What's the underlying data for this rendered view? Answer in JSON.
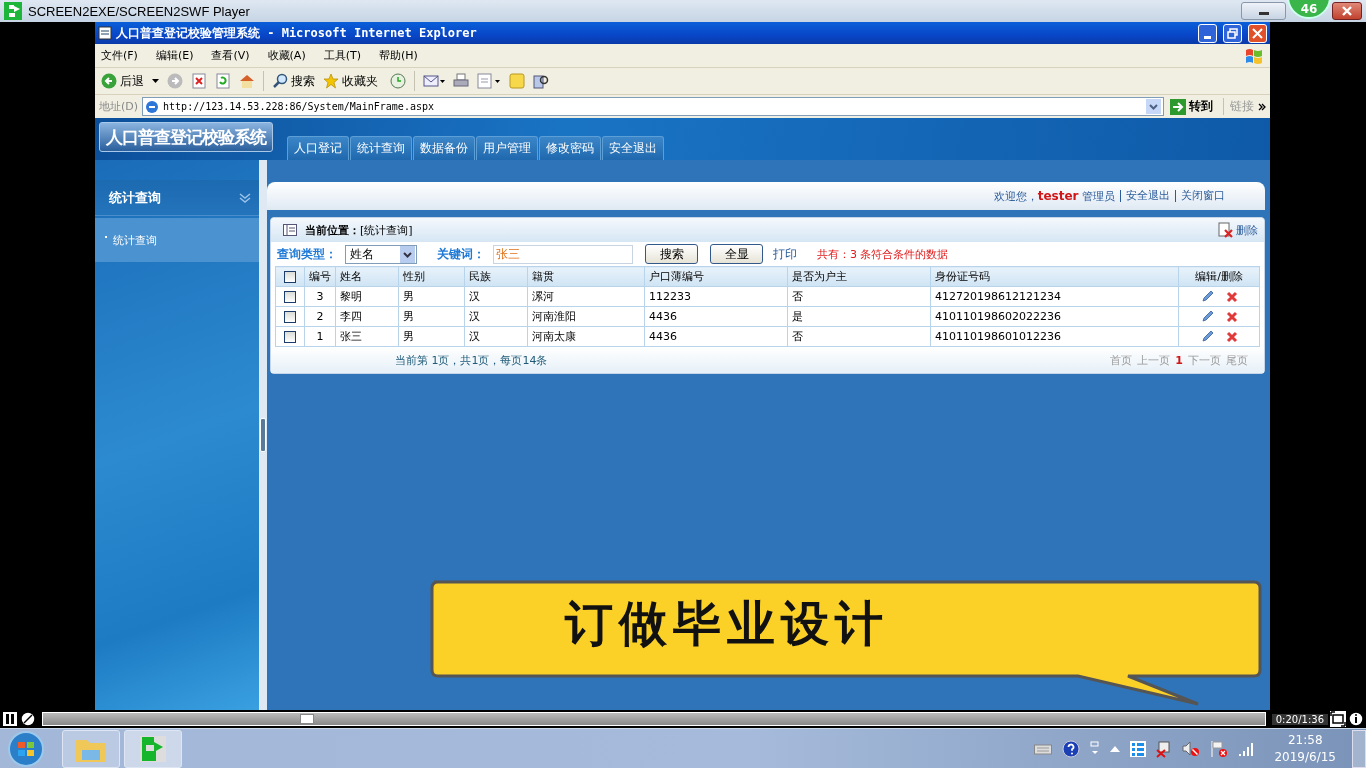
{
  "player": {
    "title": "SCREEN2EXE/SCREEN2SWF Player",
    "badge": "46",
    "level": 0.21,
    "time": "0:20/1:36"
  },
  "browser": {
    "title": "人口普查登记校验管理系统 - Microsoft Internet Explorer",
    "menu": [
      "文件(F)",
      "编辑(E)",
      "查看(V)",
      "收藏(A)",
      "工具(T)",
      "帮助(H)"
    ],
    "toolbar": {
      "back": "后退",
      "search": "搜索",
      "favorites": "收藏夹"
    },
    "address_label": "地址(D)",
    "url": "http://123.14.53.228:86/System/MainFrame.aspx",
    "go": "转到",
    "links": "链接"
  },
  "app": {
    "logo": "人口普查登记校验系统",
    "tabs": [
      "人口登记",
      "统计查询",
      "数据备份",
      "用户管理",
      "修改密码",
      "安全退出"
    ],
    "sidebar": {
      "title": "统计查询",
      "items": [
        "统计查询"
      ]
    },
    "welcome": {
      "greeting": "欢迎您，",
      "user": "tester",
      "role": "管理员",
      "links": [
        "安全退出",
        "关闭窗口"
      ]
    },
    "panel": {
      "location": "**当前位置：**[统计查询]",
      "delete": "删除",
      "search": {
        "type_label": "查询类型：",
        "type_value": "姓名",
        "keyword_label": "关键词：",
        "keyword": "张三",
        "buttons": [
          "搜索",
          "全显"
        ],
        "print": "打印",
        "summary": "共有：3 条符合条件的数据"
      },
      "table": {
        "columns": [
          "编号",
          "姓名",
          "性别",
          "民族",
          "籍贯",
          "户口薄编号",
          "是否为户主",
          "身份证号码",
          "编辑/删除"
        ],
        "all_checked": false,
        "rows": [
          {
            "checked": false,
            "cells": [
              "3",
              "黎明",
              "男",
              "汉",
              "漯河",
              "112233",
              "否",
              "412720198612121234"
            ]
          },
          {
            "checked": false,
            "cells": [
              "2",
              "李四",
              "男",
              "汉",
              "河南淮阳",
              "4436",
              "是",
              "410110198602022236"
            ]
          },
          {
            "checked": false,
            "cells": [
              "1",
              "张三",
              "男",
              "汉",
              "河南太康",
              "4436",
              "否",
              "410110198601012236"
            ]
          }
        ]
      },
      "pager": {
        "info": "当前第 1页，共1页，每页14条",
        "nav": [
          {
            "label": "首页",
            "selected": false
          },
          {
            "label": "上一页",
            "selected": false
          },
          {
            "label": "1",
            "selected": true
          },
          {
            "label": "下一页",
            "selected": false
          },
          {
            "label": "尾页",
            "selected": false
          }
        ]
      }
    }
  },
  "banner": "订做毕业设计",
  "taskbar": {
    "time": "21:58",
    "date": "2019/6/15"
  }
}
